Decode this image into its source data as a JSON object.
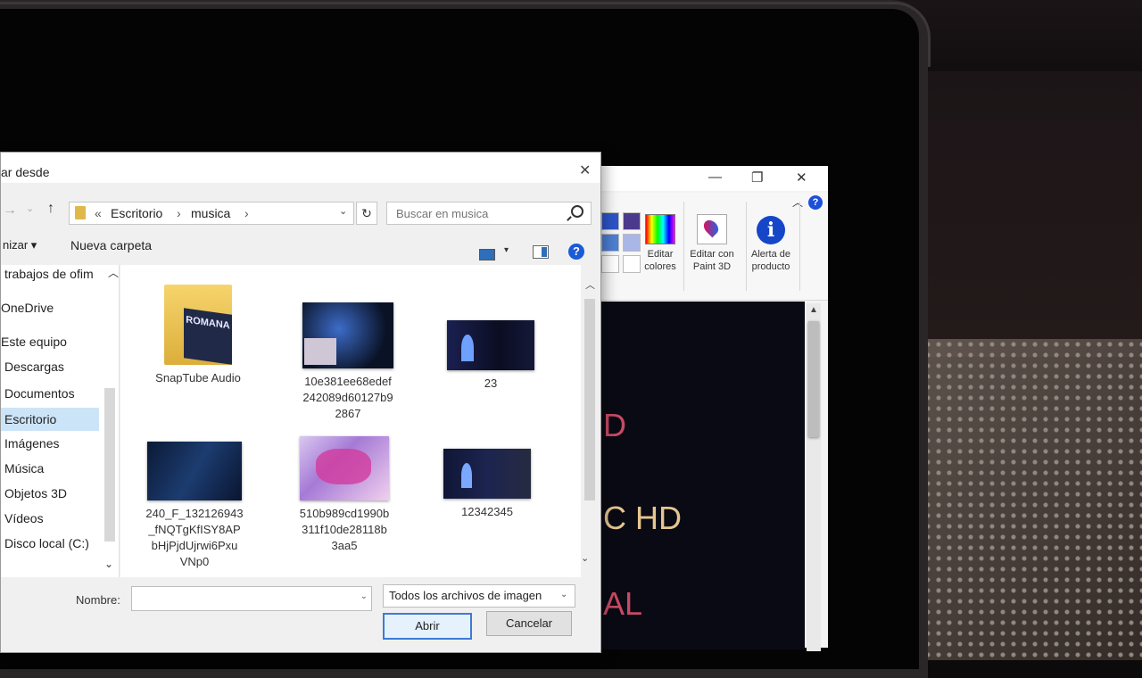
{
  "dialog": {
    "title": "ar desde",
    "address": {
      "part1": "Escritorio",
      "part2": "musica",
      "overflow": "«"
    },
    "search_placeholder": "Buscar en musica",
    "organize": "nizar ▾",
    "new_folder": "Nueva carpeta",
    "sidebar": [
      "trabajos de ofim",
      "OneDrive",
      "Este equipo",
      "Descargas",
      "Documentos",
      "Escritorio",
      "Imágenes",
      "Música",
      "Objetos 3D",
      "Vídeos",
      "Disco local (C:)"
    ],
    "files": [
      {
        "name": "SnapTube Audio"
      },
      {
        "name": "10e381ee68edef\n242089d60127b9\n2867"
      },
      {
        "name": "23"
      },
      {
        "name": "240_F_132126943\n_fNQTgKfISY8AP\nbHjPjdUjrwi6Pxu\nVNp0"
      },
      {
        "name": "510b989cd1990b\n311f10de28118b\n3aa5"
      },
      {
        "name": "12342345"
      }
    ],
    "name_label": "Nombre:",
    "name_value": "",
    "file_type": "Todos los archivos de imagen",
    "open_button": "Abrir",
    "cancel_button": "Cancelar"
  },
  "paint": {
    "edit_colors": "Editar\ncolores",
    "edit_paint3d": "Editar con\nPaint 3D",
    "product_alert": "Alerta de\nproducto",
    "canvas_lines": [
      "D",
      "C HD",
      "AL"
    ]
  },
  "colors": {
    "accent": "#1a5bd6",
    "selection": "#cce4f7",
    "canvas_red": "#c94a63",
    "canvas_gold": "#e6c690"
  }
}
